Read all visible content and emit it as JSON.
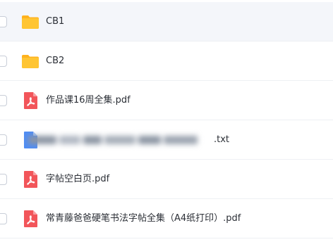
{
  "files": [
    {
      "name": "CB1",
      "type": "folder",
      "icon": "folder-icon"
    },
    {
      "name": "CB2",
      "type": "folder",
      "icon": "folder-icon"
    },
    {
      "name": "作品课16周全集.pdf",
      "type": "pdf",
      "icon": "pdf-icon"
    },
    {
      "name": ".txt",
      "type": "txt",
      "icon": "txt-file-icon",
      "redacted": true
    },
    {
      "name": "字帖空白页.pdf",
      "type": "pdf",
      "icon": "pdf-icon"
    },
    {
      "name": "常青藤爸爸硬笔书法字帖全集（A4纸打印）.pdf",
      "type": "pdf",
      "icon": "pdf-icon"
    }
  ],
  "colors": {
    "folder": "#FFC533",
    "pdf": "#F2555A",
    "txt": "#4F8DF5",
    "selected_row": "#F4F6FA"
  }
}
